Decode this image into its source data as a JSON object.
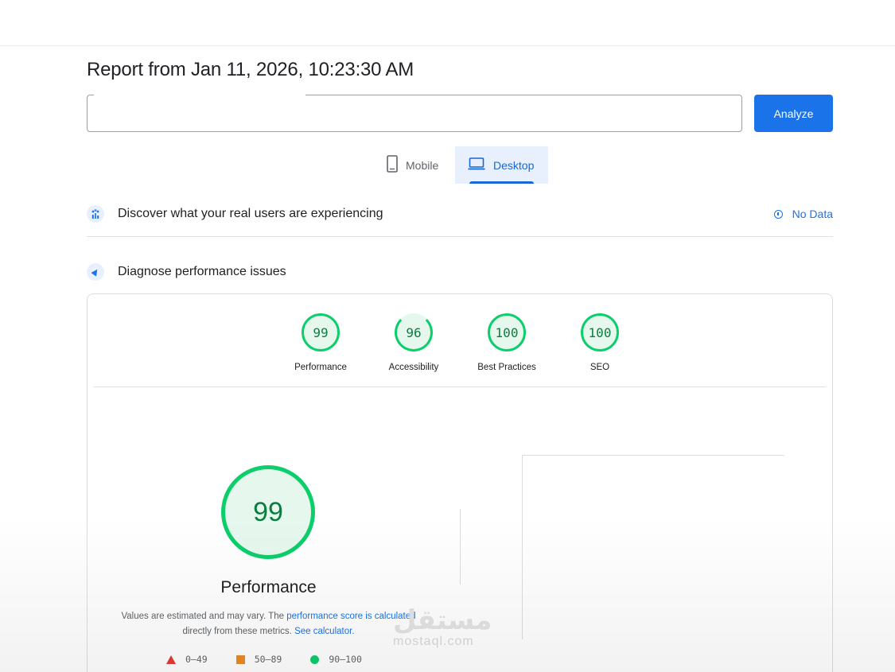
{
  "report": {
    "title": "Report from Jan 11, 2026, 10:23:30 AM"
  },
  "url_bar": {
    "value": "",
    "analyze_label": "Analyze"
  },
  "device_tabs": {
    "mobile_label": "Mobile",
    "desktop_label": "Desktop",
    "selected": "Desktop"
  },
  "field_data": {
    "title": "Discover what your real users are experiencing",
    "status": "No Data"
  },
  "lab_data": {
    "title": "Diagnose performance issues"
  },
  "scores": [
    {
      "label": "Performance",
      "value": "99"
    },
    {
      "label": "Accessibility",
      "value": "96"
    },
    {
      "label": "Best Practices",
      "value": "100"
    },
    {
      "label": "SEO",
      "value": "100"
    }
  ],
  "performance": {
    "score": "99",
    "label": "Performance",
    "desc_1": "Values are estimated and may vary. The ",
    "desc_link_1": "performance score is calculated",
    "desc_2": " directly from these metrics. ",
    "desc_link_2": "See calculator."
  },
  "legend": {
    "fail": "0–49",
    "average": "50–89",
    "pass": "90–100"
  },
  "watermark": {
    "mark": "مستقل",
    "text": "mostaql.com"
  },
  "colors": {
    "accent": "#1a73e8",
    "pass": "#0cce6b",
    "average": "#e67700",
    "fail": "#e53935"
  },
  "icons": {
    "mobile": "phone-icon",
    "desktop": "laptop-icon",
    "field_data": "users-chart-icon",
    "lab_data": "lighthouse-icon",
    "info": "info-icon"
  }
}
